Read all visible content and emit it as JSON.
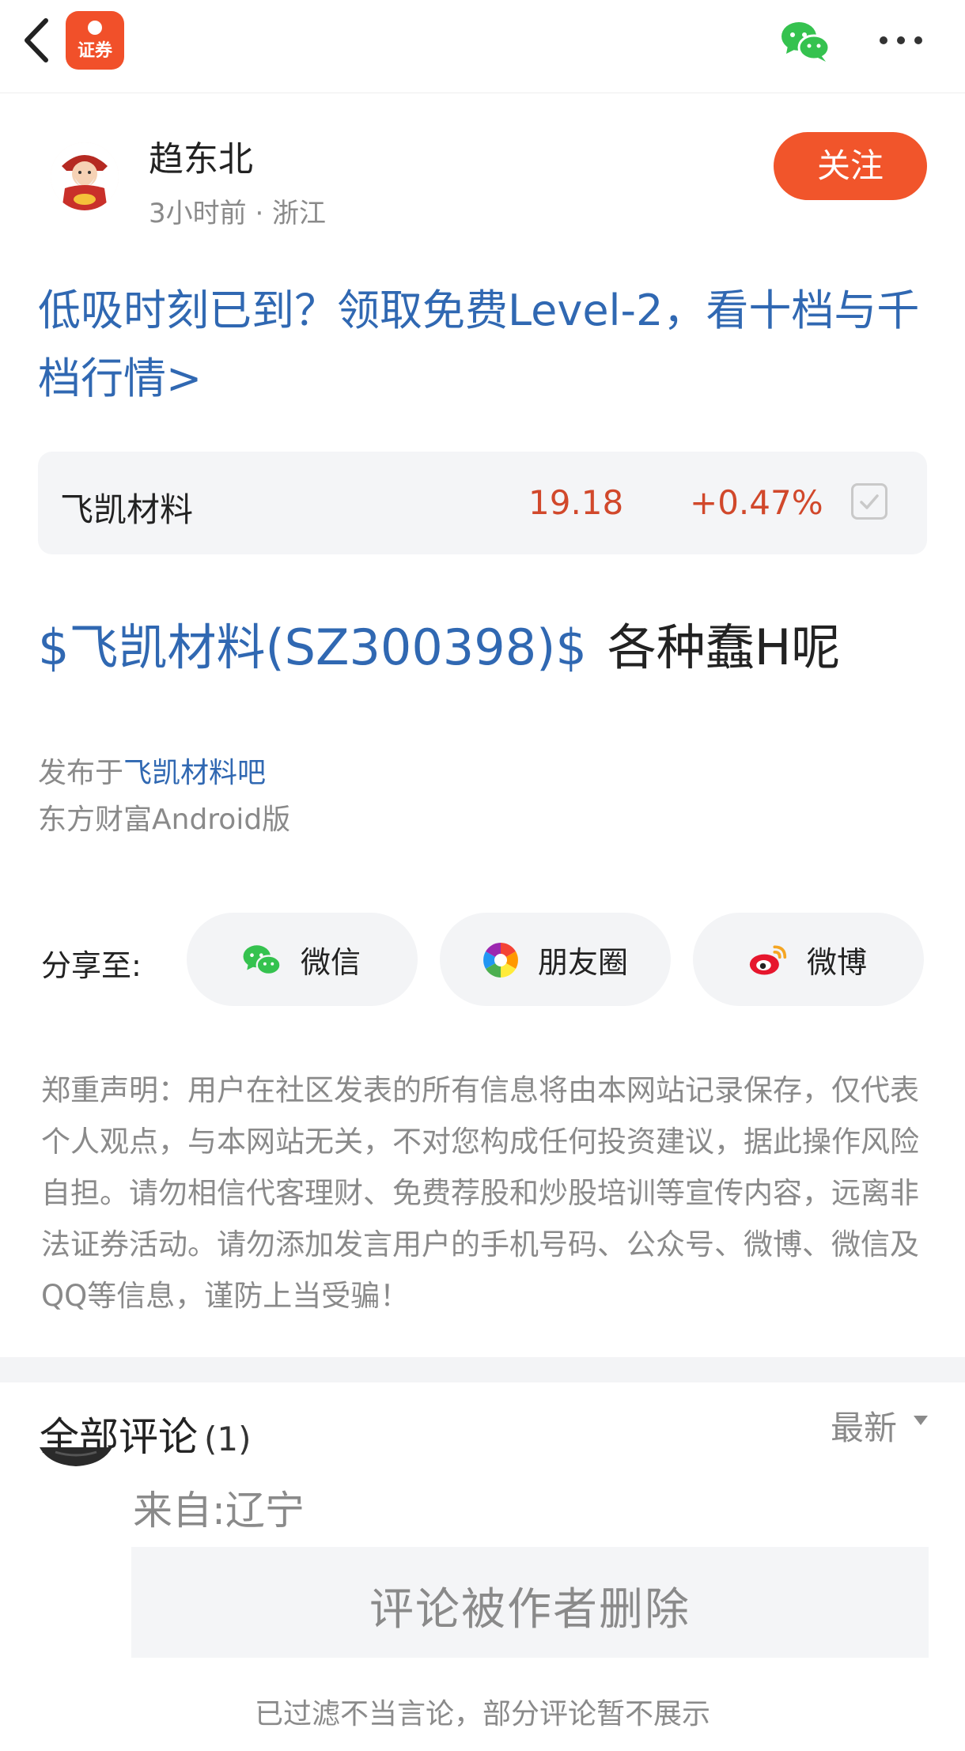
{
  "topbar": {
    "app_badge_text": "证券",
    "icons": [
      "back-icon",
      "wechat-icon",
      "more-icon"
    ]
  },
  "author": {
    "name": "趋东北",
    "meta": "3小时前 · 浙江",
    "follow_label": "关注"
  },
  "promo": {
    "text": "低吸时刻已到？领取免费Level-2，看十档与千档行情>"
  },
  "stock": {
    "name": "飞凯材料",
    "price": "19.18",
    "change": "+0.47%"
  },
  "post": {
    "stock_link": "$飞凯材料(SZ300398)$",
    "text": "各种蠢H呢",
    "posted_in_prefix": "发布于",
    "posted_in_link": "飞凯材料吧",
    "client": "东方财富Android版"
  },
  "share": {
    "label": "分享至:",
    "buttons": [
      {
        "label": "微信",
        "icon": "wechat-icon"
      },
      {
        "label": "朋友圈",
        "icon": "moments-icon"
      },
      {
        "label": "微博",
        "icon": "weibo-icon"
      }
    ]
  },
  "disclaimer": "郑重声明：用户在社区发表的所有信息将由本网站记录保存，仅代表个人观点，与本网站无关，不对您构成任何投资建议，据此操作风险自担。请勿相信代客理财、免费荐股和炒股培训等宣传内容，远离非法证券活动。请勿添加发言用户的手机号码、公众号、微博、微信及QQ等信息，谨防上当受骗！",
  "comments": {
    "title": "全部评论",
    "count": "(1)",
    "sort_label": "最新",
    "items": [
      {
        "location": "来自:辽宁",
        "deleted_text": "评论被作者删除"
      }
    ],
    "filter_note": "已过滤不当言论，部分评论暂不展示"
  },
  "colors": {
    "accent_orange": "#f1552b",
    "link_blue": "#3068b2",
    "price_red": "#d1482b",
    "muted_gray": "#8a8a8a"
  }
}
